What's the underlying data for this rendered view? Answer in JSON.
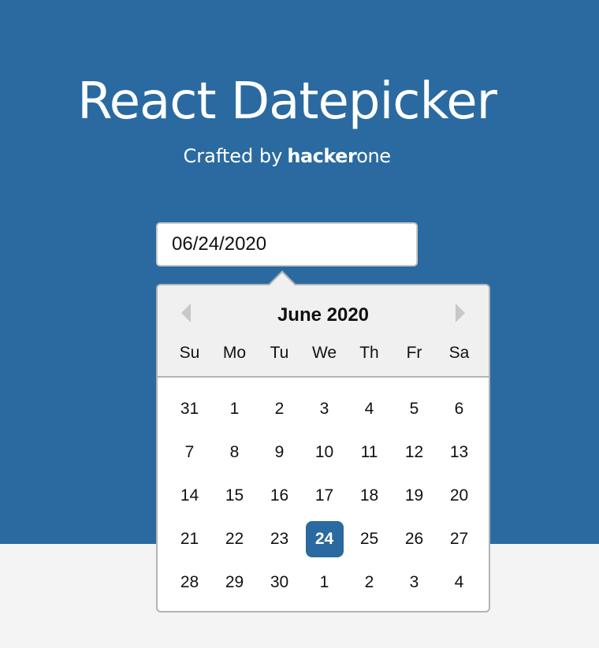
{
  "header": {
    "title": "React Datepicker",
    "crafted_prefix": "Crafted by",
    "logo_part1": "hacker",
    "logo_part2": "one"
  },
  "input": {
    "value": "06/24/2020"
  },
  "calendar": {
    "month_label": "June 2020",
    "prev_icon": "chevron-left-icon",
    "next_icon": "chevron-right-icon",
    "weekdays": [
      "Su",
      "Mo",
      "Tu",
      "We",
      "Th",
      "Fr",
      "Sa"
    ],
    "days": [
      "31",
      "1",
      "2",
      "3",
      "4",
      "5",
      "6",
      "7",
      "8",
      "9",
      "10",
      "11",
      "12",
      "13",
      "14",
      "15",
      "16",
      "17",
      "18",
      "19",
      "20",
      "21",
      "22",
      "23",
      "24",
      "25",
      "26",
      "27",
      "28",
      "29",
      "30",
      "1",
      "2",
      "3",
      "4"
    ],
    "selected_day": "24"
  },
  "colors": {
    "brand_blue": "#2a6aa0",
    "header_gray": "#f0f0f0",
    "page_bg": "#f4f4f4"
  }
}
